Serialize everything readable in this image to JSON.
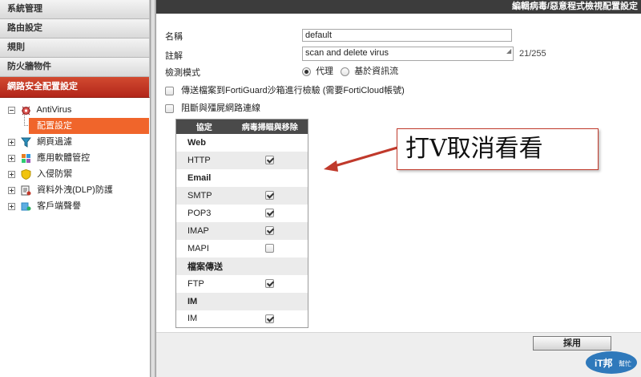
{
  "sidebar": {
    "sections": [
      "系統管理",
      "路由設定",
      "規則",
      "防火牆物件",
      "網路安全配置設定"
    ],
    "tree": [
      {
        "label": "AntiVirus",
        "expanded": true,
        "icon": "antivirus-icon"
      },
      {
        "label": "配置設定",
        "selected": true
      },
      {
        "label": "網頁過濾",
        "icon": "web-filter-icon"
      },
      {
        "label": "應用軟體管控",
        "icon": "application-control-icon"
      },
      {
        "label": "入侵防禦",
        "icon": "intrusion-protection-icon"
      },
      {
        "label": "資料外洩(DLP)防護",
        "icon": "dlp-icon"
      },
      {
        "label": "客戶端聲譽",
        "icon": "client-reputation-icon"
      }
    ]
  },
  "main": {
    "title": "編輯病毒/惡意程式檢視配置設定",
    "name_label": "名稱",
    "name_value": "default",
    "comment_label": "註解",
    "comment_value": "scan and delete virus",
    "comment_count": "21/255",
    "inspection_label": "檢測模式",
    "mode_options": [
      "代理",
      "基於資訊流"
    ],
    "fortiguard_label": "傳送檔案到FortiGuard沙箱進行檢驗 (需要FortiCloud帳號)",
    "botnet_label": "阻斷與殭屍網路連線",
    "table_headers": [
      "協定",
      "病毒掃瞄與移除"
    ],
    "rows": [
      {
        "label": "Web",
        "group": true
      },
      {
        "label": "HTTP",
        "checked": true
      },
      {
        "label": "Email",
        "group": true
      },
      {
        "label": "SMTP",
        "checked": true
      },
      {
        "label": "POP3",
        "checked": true
      },
      {
        "label": "IMAP",
        "checked": true
      },
      {
        "label": "MAPI",
        "checked": false
      },
      {
        "label": "檔案傳送",
        "group": true
      },
      {
        "label": "FTP",
        "checked": true
      },
      {
        "label": "IM",
        "group": true
      },
      {
        "label": "IM",
        "checked": true
      }
    ],
    "apply_label": "採用"
  },
  "annotation": {
    "text": "打V取消看看",
    "color": "#c0392b"
  },
  "watermark": {
    "text": "iT邦幫忙",
    "color": "#1a6bb5"
  }
}
